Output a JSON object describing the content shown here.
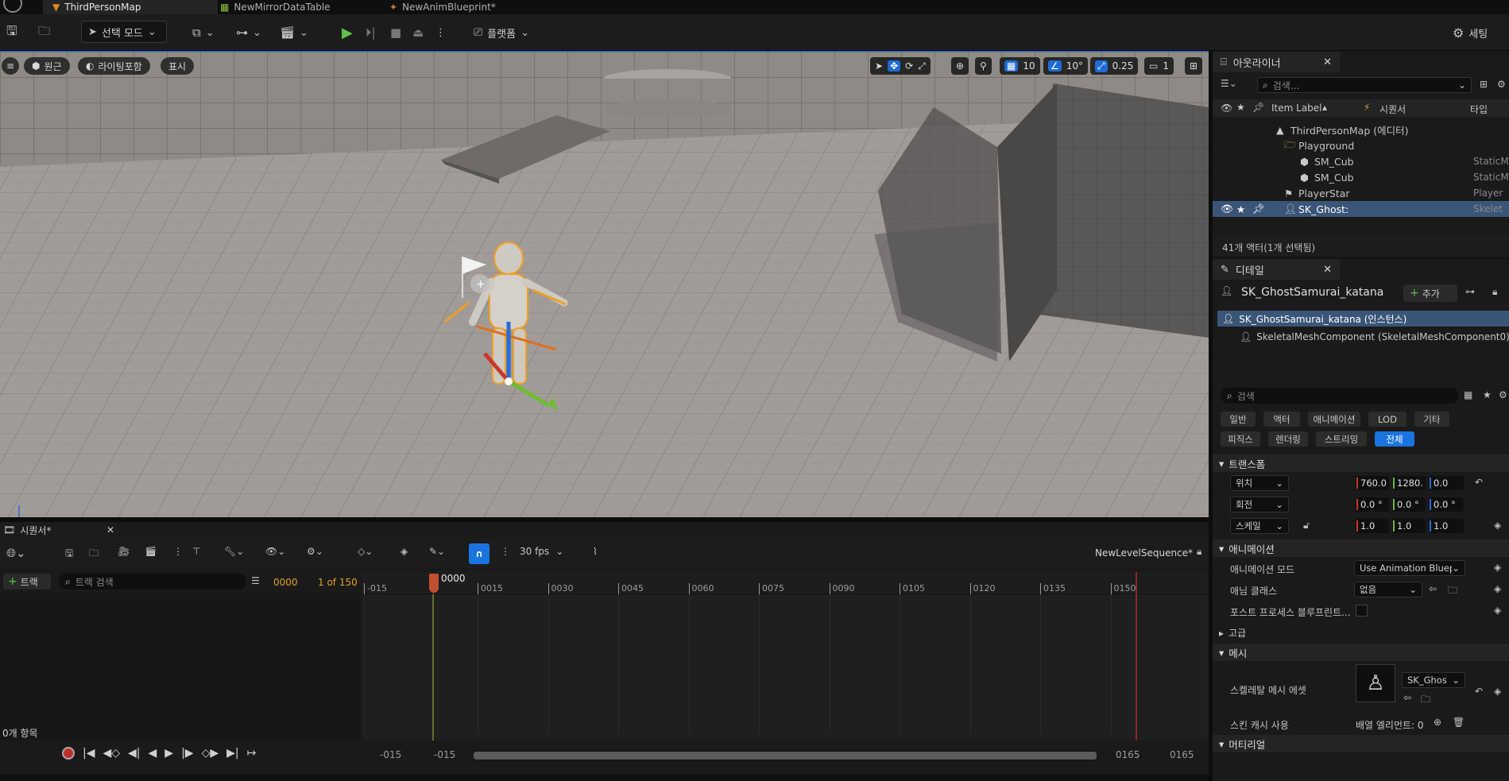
{
  "tabs": [
    {
      "label": "ThirdPersonMap",
      "active": true
    },
    {
      "label": "NewMirrorDataTable",
      "active": false
    },
    {
      "label": "NewAnimBlueprint*",
      "active": false
    }
  ],
  "toolbar": {
    "mode_label": "선택 모드",
    "platforms_label": "플랫폼",
    "settings_label": "세팅"
  },
  "viewport": {
    "perspective_label": "원근",
    "lighting_label": "라이팅포함",
    "show_label": "표시",
    "grid_snap": "10",
    "rot_snap": "10°",
    "scale_snap": "0.25",
    "camera_speed": "1"
  },
  "outliner": {
    "tab_label": "아웃라이너",
    "search_placeholder": "검색...",
    "col_item_label": "Item Label",
    "col_sequencer": "시퀀서",
    "col_type": "타입",
    "rows": [
      {
        "label": "ThirdPersonMap (에디터)",
        "type": "",
        "indent": 80,
        "icon": "level"
      },
      {
        "label": "Playground",
        "type": "",
        "indent": 90,
        "icon": "folder"
      },
      {
        "label": "SM_Cub",
        "type": "StaticM",
        "indent": 110,
        "icon": "mesh"
      },
      {
        "label": "SM_Cub",
        "type": "StaticM",
        "indent": 110,
        "icon": "mesh"
      },
      {
        "label": "PlayerStar",
        "type": "Player",
        "indent": 90,
        "icon": "player"
      },
      {
        "label": "SK_Ghost:",
        "type": "Skelet",
        "indent": 90,
        "icon": "skeletal",
        "selected": true
      }
    ],
    "footer": "41개 액터(1개 선택됨)"
  },
  "details": {
    "tab_label": "디테일",
    "actor_name": "SK_GhostSamurai_katana",
    "add_label": "추가",
    "instance_label": "SK_GhostSamurai_katana (인스턴스)",
    "component_label": "SkeletalMeshComponent (SkeletalMeshComponent0)",
    "search_placeholder": "검색",
    "filters_row1": [
      "일반",
      "액터",
      "애니메이션",
      "LOD",
      "기타"
    ],
    "filters_row2": [
      "피직스",
      "렌더링",
      "스트리밍",
      "전체"
    ],
    "transform_section": "트랜스폼",
    "location_label": "위치",
    "location": [
      "760.0",
      "1280.",
      "0.0"
    ],
    "rotation_label": "회전",
    "rotation": [
      "0.0 °",
      "0.0 °",
      "0.0 °"
    ],
    "scale_label": "스케일",
    "scale": [
      "1.0",
      "1.0",
      "1.0"
    ],
    "animation_section": "애니메이션",
    "anim_mode_label": "애니메이션 모드",
    "anim_mode_value": "Use Animation Bluep",
    "anim_class_label": "애님 클래스",
    "anim_class_value": "없음",
    "post_process_label": "포스트 프로세스 블루프린트...",
    "advanced_section": "고급",
    "mesh_section": "메시",
    "skeletal_mesh_label": "스켈레탈 메시 에셋",
    "skeletal_mesh_value": "SK_Ghos",
    "skin_cache_label": "스킨 캐시 사용",
    "array_elements": "배열 엘리먼트: 0",
    "material_section": "머티리얼"
  },
  "sequencer": {
    "tab_label": "시퀀서*",
    "fps_label": "30 fps",
    "sequence_name": "NewLevelSequence*",
    "add_track_label": "트랙",
    "track_search_placeholder": "트랙 검색",
    "current_frame": "0000",
    "frame_counter": "1 of 150",
    "playhead_label": "0000",
    "ruler_ticks": [
      "-015",
      "0015",
      "0030",
      "0045",
      "0060",
      "0075",
      "0090",
      "0105",
      "0120",
      "0135",
      "0150"
    ],
    "items_count": "0개 항목",
    "range_start_outer": "-015",
    "range_start_inner": "-015",
    "range_end_inner": "0165",
    "range_end_outer": "0165"
  },
  "colors": {
    "accent": "#1a74e0",
    "selection": "#3a5577",
    "play_green": "#5ec24a",
    "playhead": "#c0502e"
  }
}
